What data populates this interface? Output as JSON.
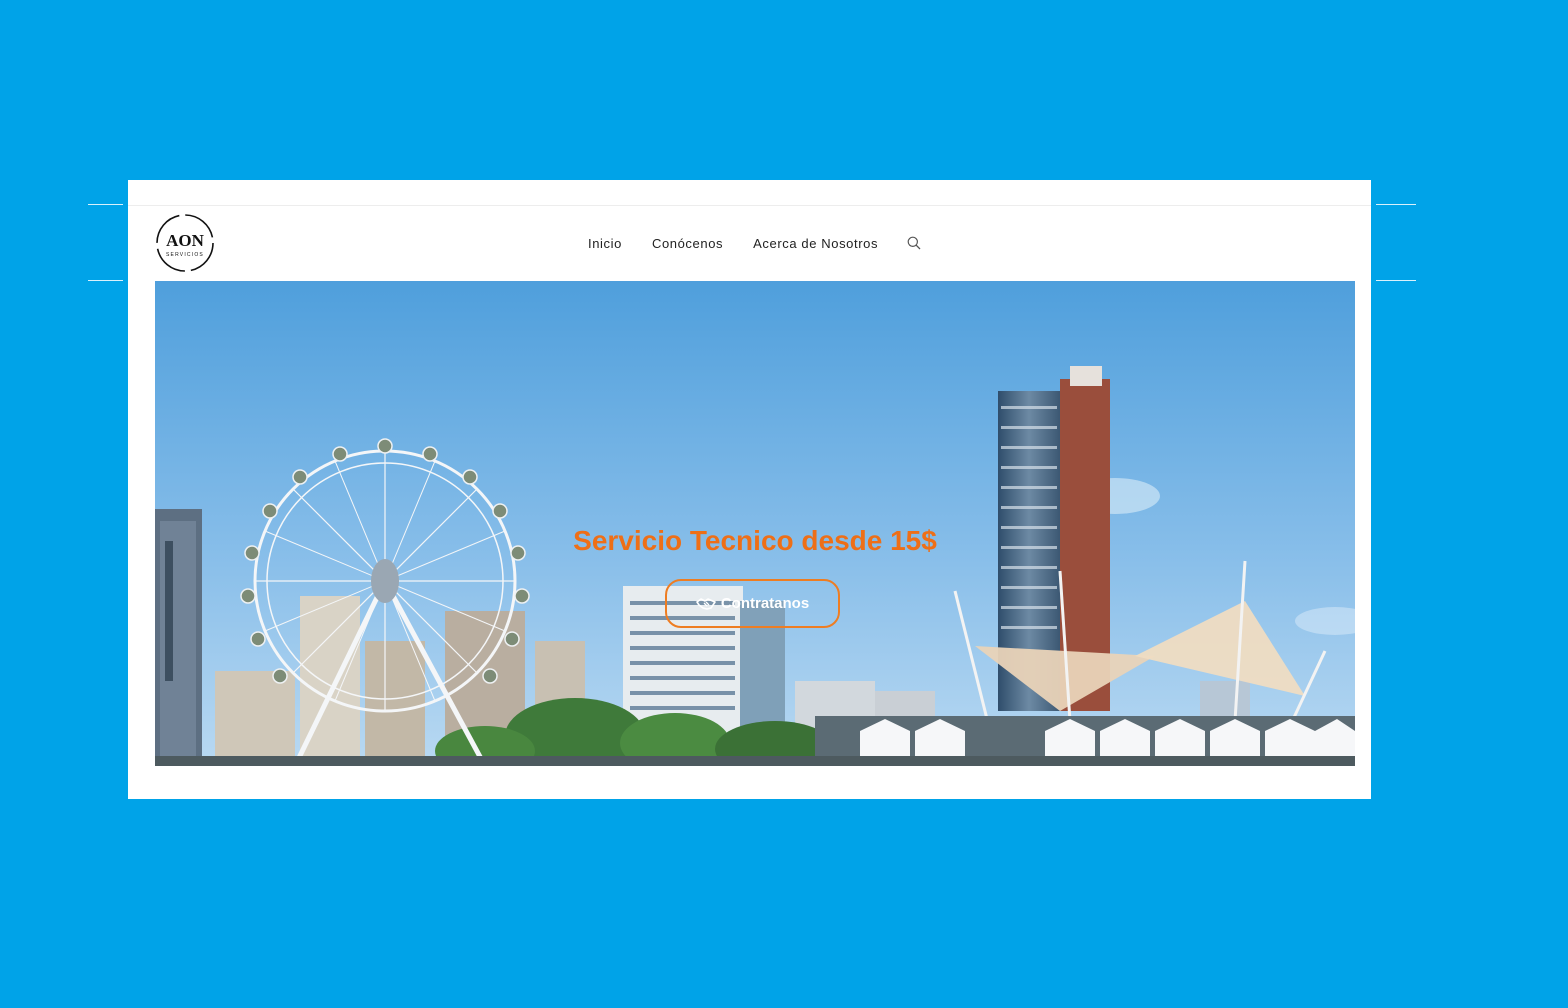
{
  "colors": {
    "background": "#00a3e8",
    "accent": "#ee6f17",
    "nav_text": "#222222",
    "card": "#ffffff"
  },
  "header": {
    "logo": {
      "text": "AON",
      "subtext": "SERVICIOS"
    },
    "nav": {
      "items": [
        {
          "label": "Inicio"
        },
        {
          "label": "Conócenos"
        },
        {
          "label": "Acerca de Nosotros"
        }
      ],
      "search_icon": "search-icon"
    }
  },
  "hero": {
    "title": "Servicio Tecnico desde 15$",
    "button": {
      "label": "Contratanos",
      "icon": "handshake-icon"
    },
    "image": "city-waterfront-ferris-wheel"
  }
}
